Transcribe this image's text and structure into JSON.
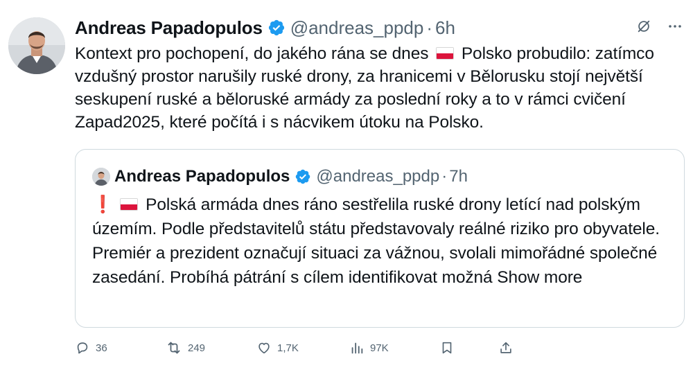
{
  "tweet": {
    "author_name": "Andreas Papadopulos",
    "handle": "@andreas_ppdp",
    "separator": "·",
    "time": "6h",
    "text_before_flag": "Kontext pro pochopení, do jakého rána se dnes",
    "text_after_flag": "Polsko probudilo: zatímco vzdušný prostor narušily ruské drony, za hranicemi v Bělorusku stojí největší seskupení ruské a běloruské armády za poslední roky a to v rámci cvičení Zapad2025, které počítá i s nácvikem útoku na Polsko."
  },
  "quote": {
    "author_name": "Andreas Papadopulos",
    "handle": "@andreas_ppdp",
    "separator": "·",
    "time": "7h",
    "exclamation": "❗",
    "text": "Polská armáda dnes ráno sestřelila ruské drony letící nad polským územím. Podle představitelů státu představovaly reálné riziko pro obyvatele. Premiér a prezident označují situaci za vážnou, svolali mimořádné společné zasedání. Probíhá pátrání s cílem identifikovat možná",
    "show_more": "Show more"
  },
  "actions": {
    "replies": "36",
    "reposts": "249",
    "likes": "1,7K",
    "views": "97K"
  },
  "colors": {
    "text": "#0f1419",
    "secondary": "#536471",
    "verified": "#1d9bf0",
    "border": "#cfd9de",
    "flag_red": "#dc143c"
  },
  "icons": [
    "verified-badge-icon",
    "grok-icon",
    "more-icon",
    "reply-icon",
    "repost-icon",
    "like-icon",
    "views-icon",
    "bookmark-icon",
    "share-icon",
    "poland-flag-icon",
    "exclamation-icon"
  ]
}
